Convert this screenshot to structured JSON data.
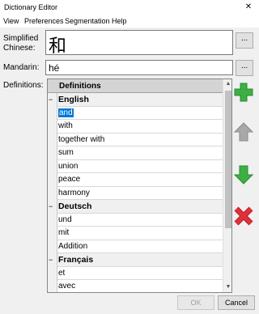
{
  "window": {
    "title": "Dictionary Editor",
    "close_symbol": "✕"
  },
  "menu": [
    "View",
    "Preferences",
    "Segmentation",
    "Help"
  ],
  "form": {
    "simplified_label_1": "Simplified",
    "simplified_label_2": "Chinese:",
    "simplified_value": "和",
    "mandarin_label": "Mandarin:",
    "mandarin_value": "hé",
    "ellipsis": "...",
    "definitions_label": "Definitions:"
  },
  "grid": {
    "header": "Definitions",
    "rows": [
      {
        "type": "group",
        "text": "English"
      },
      {
        "type": "item",
        "text": "and",
        "selected": true
      },
      {
        "type": "item",
        "text": "with"
      },
      {
        "type": "item",
        "text": "together with"
      },
      {
        "type": "item",
        "text": "sum"
      },
      {
        "type": "item",
        "text": "union"
      },
      {
        "type": "item",
        "text": "peace"
      },
      {
        "type": "item",
        "text": "harmony"
      },
      {
        "type": "group",
        "text": "Deutsch"
      },
      {
        "type": "item",
        "text": "und"
      },
      {
        "type": "item",
        "text": "mit"
      },
      {
        "type": "item",
        "text": "Addition"
      },
      {
        "type": "group",
        "text": "Français"
      },
      {
        "type": "item",
        "text": "et"
      },
      {
        "type": "item",
        "text": "avec"
      }
    ]
  },
  "icons": {
    "add": "plus-icon",
    "up": "arrow-up-icon",
    "down": "arrow-down-icon",
    "delete": "delete-x-icon"
  },
  "buttons": {
    "ok": "OK",
    "cancel": "Cancel"
  },
  "colors": {
    "add_green": "#3cb043",
    "down_green": "#3cb043",
    "up_gray": "#a8a8a8",
    "delete_red": "#e0303a",
    "selection": "#0078d7"
  }
}
